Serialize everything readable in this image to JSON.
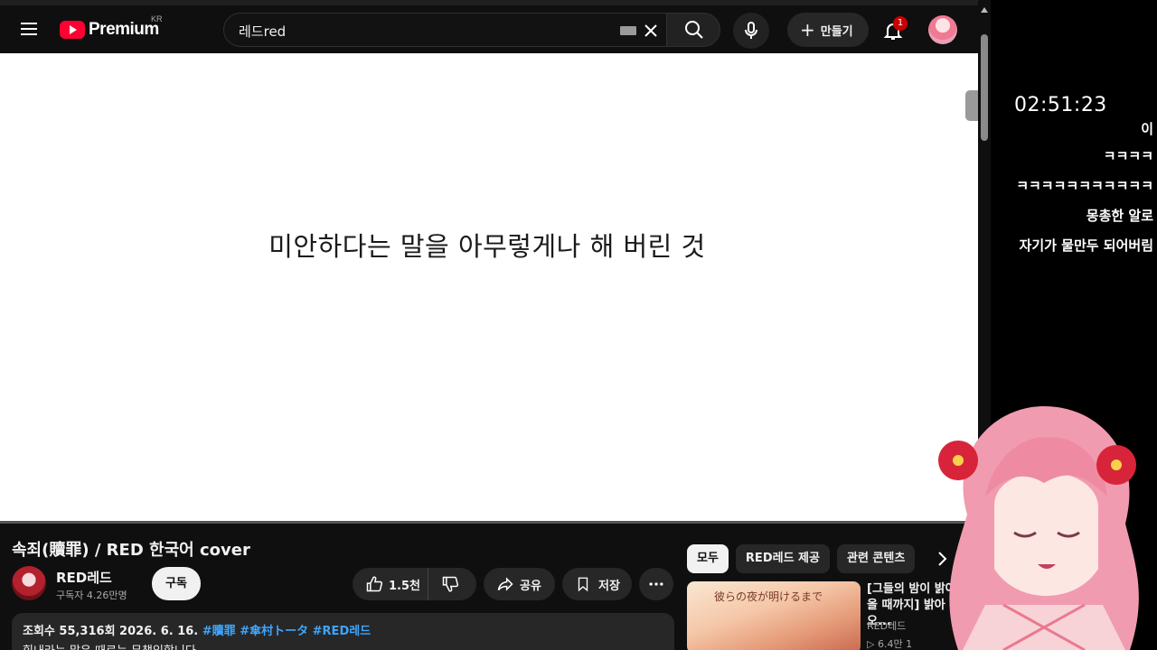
{
  "masthead": {
    "logo_text": "Premium",
    "country_code": "KR",
    "search_value": "레드red",
    "create_label": "만들기",
    "notification_count": "1"
  },
  "player": {
    "lyric": "미안하다는 말을 아무렇게나 해 버린 것"
  },
  "video": {
    "title": "속죄(贖罪) / RED 한국어 cover",
    "channel_name": "RED레드",
    "subscribers": "구독자 4.26만명",
    "subscribe_label": "구독",
    "like_count": "1.5천",
    "share_label": "공유",
    "save_label": "저장",
    "description": {
      "views_date": "조회수 55,316회  2026. 6. 16.",
      "tags": [
        "#贖罪",
        "#傘村トータ",
        "#RED레드"
      ],
      "first_line": "힘내라는 말은 때로는 무책임합니다"
    }
  },
  "chips": [
    "모두",
    "RED레드 제공",
    "관련 콘텐츠"
  ],
  "recommendation": {
    "thumbnail_text": "彼らの夜が明けるまで",
    "title": "[그들의 밤이 밝아올 때까지] 밝아오...",
    "channel": "RED레드",
    "stats": "▷ 6.4만  1"
  },
  "overlay": {
    "clock": "02:51:23",
    "chat": [
      "이",
      "ㅋㅋㅋㅋ",
      "ㅋㅋㅋㅋㅋㅋㅋㅋㅋㅋㅋ",
      "몽총한 알로",
      "자기가 물만두 되어버림"
    ]
  },
  "colors": {
    "background": "#0f0f0f",
    "brand_red": "#ff0033",
    "link_blue": "#3ea6ff",
    "chip_active": "#f1f1f1"
  },
  "icons": [
    "menu-icon",
    "youtube-logo-icon",
    "keyboard-icon",
    "close-icon",
    "search-icon",
    "mic-icon",
    "plus-icon",
    "bell-icon",
    "like-icon",
    "dislike-icon",
    "share-icon",
    "bookmark-icon",
    "more-icon",
    "chevron-right-icon"
  ]
}
